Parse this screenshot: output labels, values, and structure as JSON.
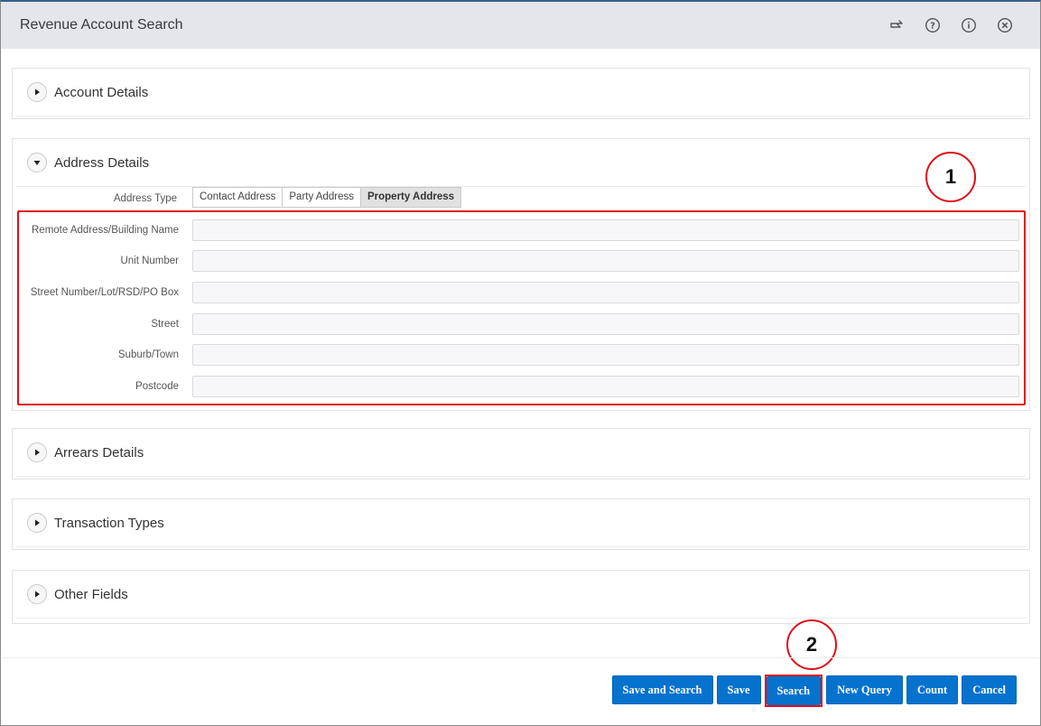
{
  "window": {
    "title": "Revenue Account Search",
    "icons": [
      "redirect-icon",
      "help-icon",
      "info-icon",
      "close-icon"
    ]
  },
  "sections": {
    "account_details": "Account Details",
    "address_details": "Address Details",
    "arrears_details": "Arrears Details",
    "transaction_types": "Transaction Types",
    "other_fields": "Other Fields"
  },
  "address": {
    "type_label": "Address Type",
    "types": [
      "Contact Address",
      "Party Address",
      "Property Address"
    ],
    "selected_type": "Property Address",
    "fields": [
      {
        "label": "Remote Address/Building Name",
        "value": ""
      },
      {
        "label": "Unit Number",
        "value": ""
      },
      {
        "label": "Street Number/Lot/RSD/PO Box",
        "value": ""
      },
      {
        "label": "Street",
        "value": ""
      },
      {
        "label": "Suburb/Town",
        "value": ""
      },
      {
        "label": "Postcode",
        "value": ""
      }
    ]
  },
  "annotations": {
    "marker1": "1",
    "marker2": "2",
    "highlight_color": "#e0101a"
  },
  "buttons": {
    "save_and_search": "Save and Search",
    "save": "Save",
    "search": "Search",
    "new_query": "New Query",
    "count": "Count",
    "cancel": "Cancel",
    "color": "#0572ce"
  }
}
